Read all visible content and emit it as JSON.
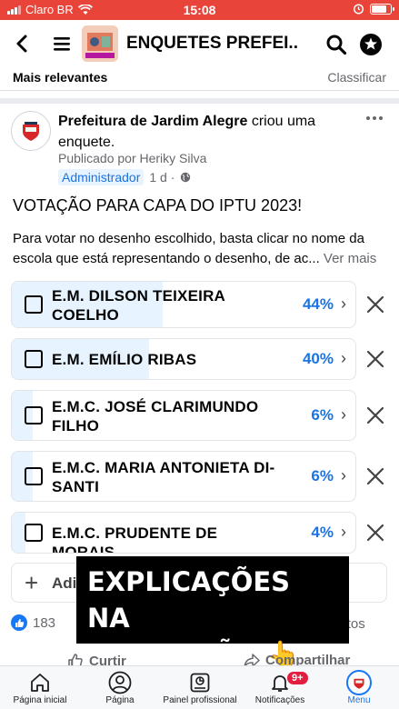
{
  "status_bar": {
    "carrier": "Claro BR",
    "time": "15:08"
  },
  "header": {
    "title": "ENQUETES PREFEI..."
  },
  "sort": {
    "label": "Mais relevantes",
    "action": "Classificar"
  },
  "post": {
    "author": "Prefeitura de Jardim Alegre",
    "action_text": " criou uma enquete.",
    "posted_by": "Publicado por Heriky Silva",
    "role": "Administrador",
    "time": "1 d ·"
  },
  "poll": {
    "title": "VOTAÇÃO PARA CAPA DO IPTU 2023!",
    "description": "Para votar no desenho escolhido, basta clicar no nome da escola que está representando o desenho, de ac...",
    "see_more": " Ver mais",
    "options": [
      {
        "line1": "E.M. DILSON TEIXEIRA",
        "line2": "COELHO",
        "percent_label": "44%",
        "percent": 44
      },
      {
        "line1": "E.M. EMÍLIO RIBAS",
        "line2": "",
        "percent_label": "40%",
        "percent": 40
      },
      {
        "line1": "E.M.C. JOSÉ CLARIMUNDO",
        "line2": "FILHO",
        "percent_label": "6%",
        "percent": 6
      },
      {
        "line1": "E.M.C. MARIA ANTONIETA DI-",
        "line2": "SANTI",
        "percent_label": "6%",
        "percent": 6
      },
      {
        "line1": "E.M.C. PRUDENTE DE MORAIS",
        "line2": "",
        "percent_label": "4%",
        "percent": 4
      }
    ],
    "add_option_label": "Adi"
  },
  "overlay": {
    "line1": "EXPLICAÇÕES NA",
    "line2": "DESCRIÇÃO 👆"
  },
  "engagement": {
    "reactions_count": "183",
    "shares_label": "rtilhamentos"
  },
  "actions": {
    "like": "Curtir",
    "share": "Compartilhar"
  },
  "tabbar": {
    "home": "Página inicial",
    "page": "Página",
    "dashboard": "Painel profissional",
    "notifications": "Notificações",
    "notifications_badge": "9+",
    "menu": "Menu"
  },
  "colors": {
    "accent": "#1877f2",
    "poll_fill": "#e7f3ff",
    "status_bar": "#e8443a"
  }
}
